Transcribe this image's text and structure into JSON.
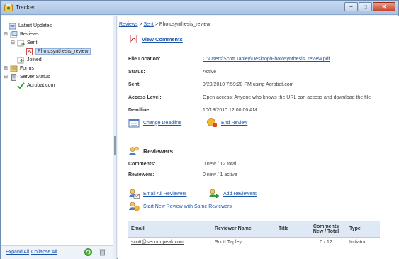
{
  "window": {
    "title": "Tracker",
    "colors": {
      "accent": "#1c54a8",
      "titlebar": "#b3cae8",
      "table_header": "#dfe9f6"
    }
  },
  "sidebar": {
    "items": [
      {
        "label": "Latest Updates",
        "icon": "updates-icon"
      },
      {
        "label": "Reviews",
        "icon": "reviews-icon"
      },
      {
        "label": "Sent",
        "icon": "sent-icon"
      },
      {
        "label": "Photosynthesis_review",
        "icon": "pdf-icon"
      },
      {
        "label": "Joined",
        "icon": "joined-icon"
      },
      {
        "label": "Forms",
        "icon": "forms-icon"
      },
      {
        "label": "Server Status",
        "icon": "server-icon"
      },
      {
        "label": "Acrobat.com",
        "icon": "check-icon"
      }
    ],
    "expand_all": "Expand All",
    "collapse_all": "Collapse All"
  },
  "breadcrumb": {
    "reviews": "Reviews",
    "sent": "Sent",
    "current": "Photosynthesis_review",
    "sep": ">"
  },
  "view_comments": "View Comments",
  "details": {
    "file_location_label": "File Location:",
    "file_location_value": "C:\\Users\\Scott Tapley\\Desktop\\Photosynthesis_review.pdf",
    "status_label": "Status:",
    "status_value": "Active",
    "sent_label": "Sent:",
    "sent_value": "9/29/2010 7:59:20 PM using Acrobat.com",
    "access_label": "Access Level:",
    "access_value": "Open access: Anyone who knows the URL can access and download the file",
    "deadline_label": "Deadline:",
    "deadline_value": "10/13/2010 12:00:00 AM"
  },
  "actions": {
    "change_deadline": "Change Deadline",
    "end_review": "End Review",
    "email_all": "Email All Reviewers",
    "add_reviewers": "Add Reviewers",
    "new_review": "Start New Review with Same Reviewers"
  },
  "reviewers_section": {
    "title": "Reviewers",
    "comments_label": "Comments:",
    "comments_value": "0 new / 12 total",
    "reviewers_label": "Reviewers:",
    "reviewers_value": "0 new / 1 active"
  },
  "table": {
    "headers": {
      "email": "Email",
      "name": "Reviewer Name",
      "title": "Title",
      "comments": "Comments New / Total",
      "type": "Type"
    },
    "rows": [
      {
        "email": "scott@secondpeak.com",
        "name": "Scott Tapley",
        "title": "",
        "comments": "0 / 12",
        "type": "Initiator"
      }
    ]
  }
}
